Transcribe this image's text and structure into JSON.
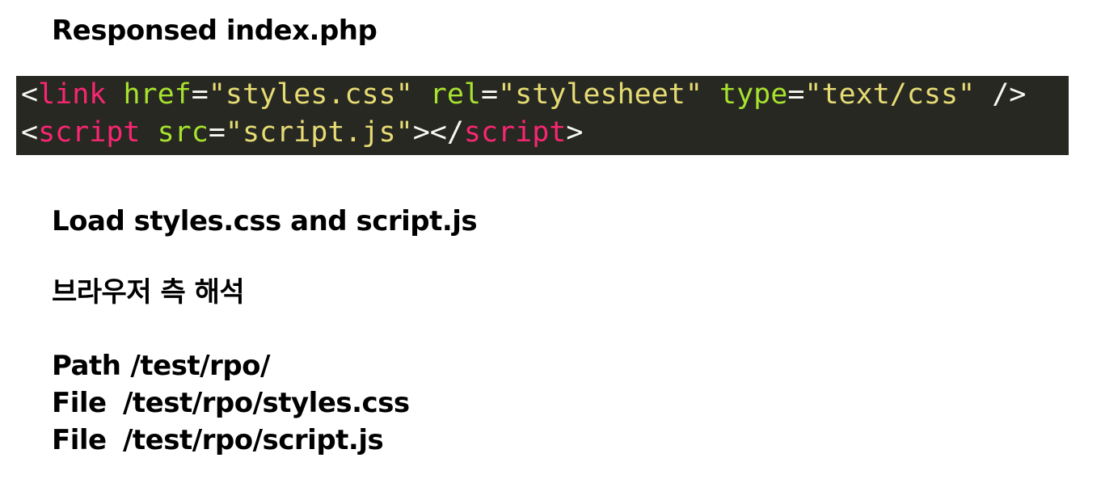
{
  "title": "Responsed index.php",
  "code": {
    "line1": {
      "lt": "<",
      "tag": "link",
      "attr1": "href",
      "eq1": "=",
      "val1": "\"styles.css\"",
      "attr2": "rel",
      "eq2": "=",
      "val2": "\"stylesheet\"",
      "attr3": "type",
      "eq3": "=",
      "val3": "\"text/css\"",
      "close": "/>"
    },
    "line2": {
      "lt": "<",
      "tag": "script",
      "attr1": "src",
      "eq1": "=",
      "val1": "\"script.js\"",
      "gt_close_open": "></",
      "tag_close": "script",
      "gt": ">"
    }
  },
  "load_text": "Load styles.css and script.js",
  "browser_text": "브라우저 측 해석",
  "paths": {
    "path_label": "Path",
    "path_value": "/test/rpo/",
    "file1_label": "File",
    "file1_value": "/test/rpo/styles.css",
    "file2_label": "File",
    "file2_value": "/test/rpo/script.js"
  },
  "colors": {
    "code_background": "#272822",
    "tag": "#f92672",
    "attribute": "#a6e22e",
    "string": "#e6db74",
    "punctuation": "#f8f8f2"
  }
}
